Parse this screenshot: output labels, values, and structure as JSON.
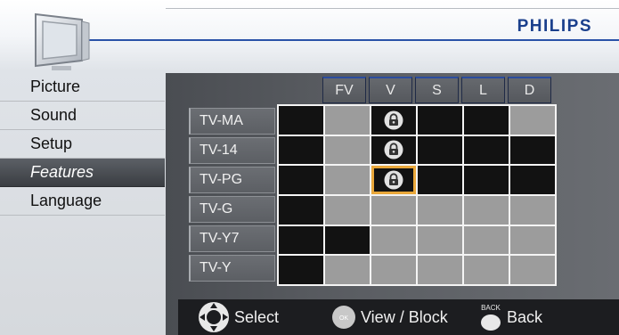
{
  "brand": "PHILIPS",
  "menu": {
    "items": [
      {
        "label": "Picture"
      },
      {
        "label": "Sound"
      },
      {
        "label": "Setup"
      },
      {
        "label": "Features"
      },
      {
        "label": "Language"
      }
    ],
    "selected": "Features"
  },
  "grid": {
    "columns": [
      "FV",
      "V",
      "S",
      "L",
      "D"
    ],
    "rows": [
      "TV-MA",
      "TV-14",
      "TV-PG",
      "TV-G",
      "TV-Y7",
      "TV-Y"
    ]
  },
  "footer": {
    "select_label": "Select",
    "ok_label": "OK",
    "view_block_label": "View / Block",
    "back_caption": "BACK",
    "back_label": "Back"
  },
  "colors": {
    "brand": "#1a3f8c",
    "focus": "#e9a73a",
    "blocked_cell": "#9c9c9c",
    "open_cell": "#121212"
  }
}
